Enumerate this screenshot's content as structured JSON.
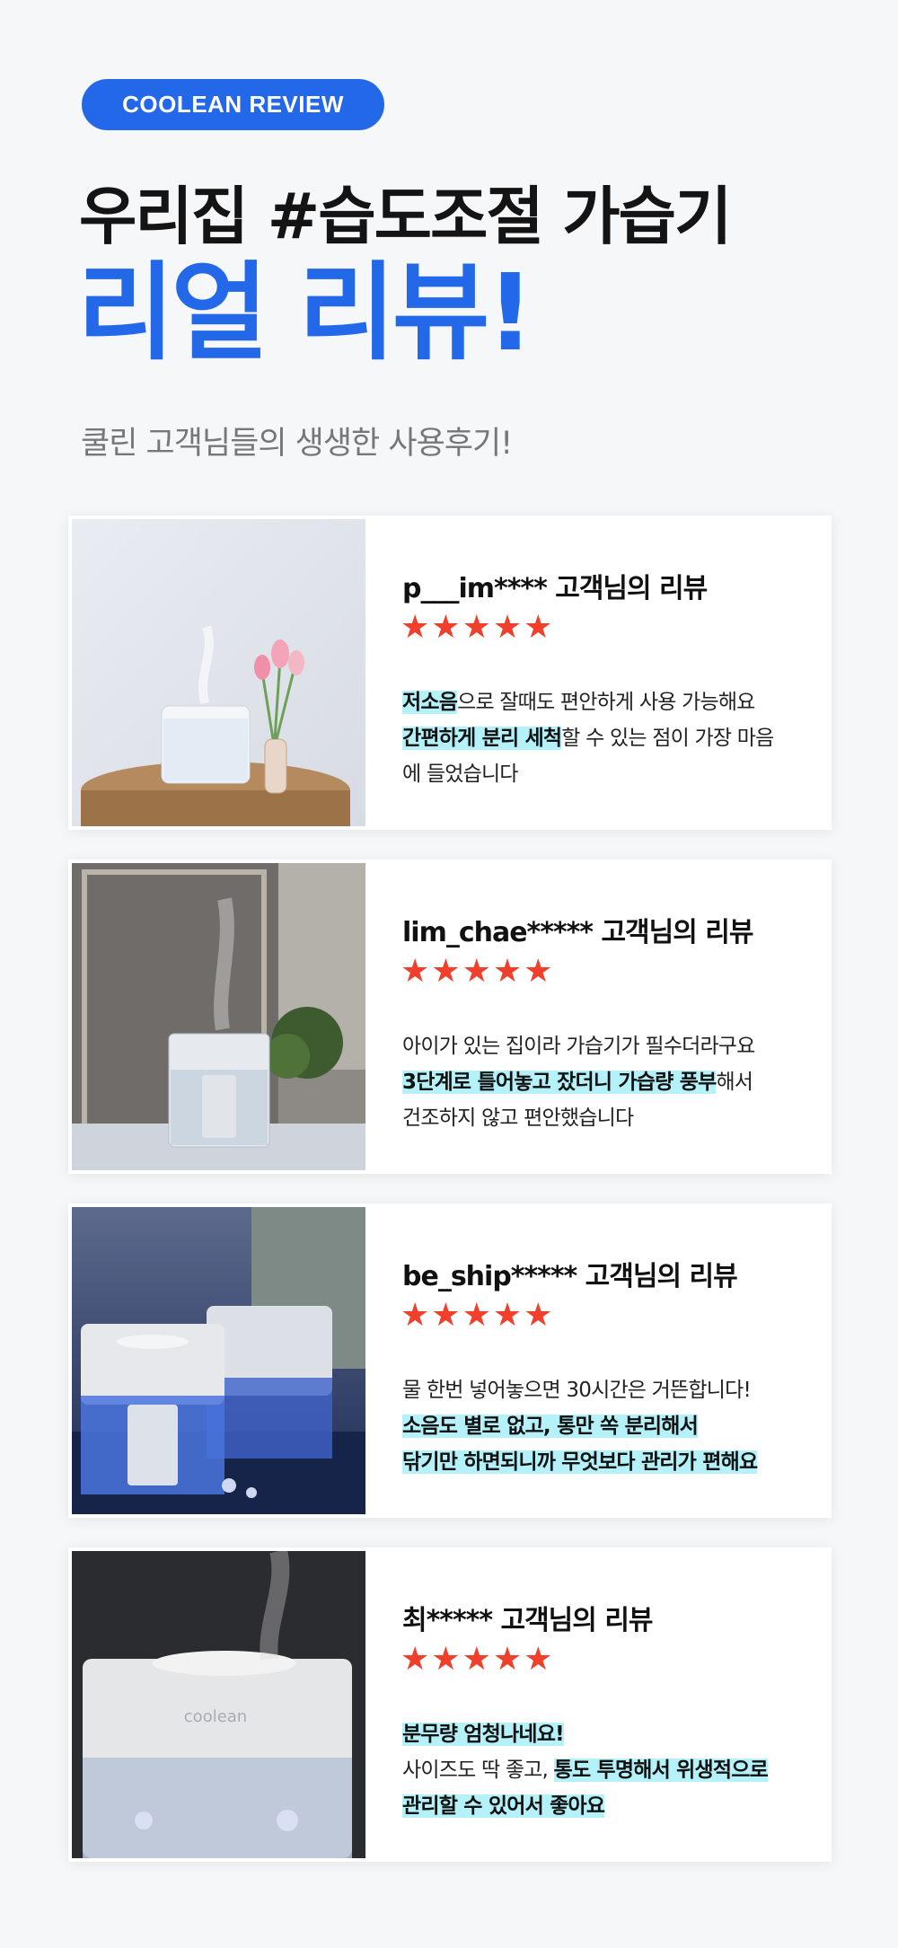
{
  "badge": "COOLEAN REVIEW",
  "title_line1": "우리집 #습도조절 가습기",
  "title_line2": "리얼 리뷰!",
  "subtitle": "쿨린 고객님들의 생생한 사용후기!",
  "colors": {
    "accent": "#2468ea",
    "star": "#f0402c",
    "highlight": "#b5f1f9"
  },
  "reviews": [
    {
      "reviewer": "p___im**** 고객님의 리뷰",
      "rating": 5,
      "photo": "humidifier-with-tulips",
      "lines": [
        [
          {
            "t": "저소음",
            "hl": true
          },
          {
            "t": "으로 잘때도 편안하게 사용 가능해요",
            "hl": false
          }
        ],
        [
          {
            "t": "간편하게 분리 세척",
            "hl": true
          },
          {
            "t": "할 수 있는 점이 가장 마음",
            "hl": false
          }
        ],
        [
          {
            "t": "에 들었습니다",
            "hl": false
          }
        ]
      ]
    },
    {
      "reviewer": "lim_chae***** 고객님의 리뷰",
      "rating": 5,
      "photo": "humidifier-with-plants",
      "lines": [
        [
          {
            "t": "아이가 있는 집이라 가습기가 필수더라구요",
            "hl": false
          }
        ],
        [
          {
            "t": "3단계로 틀어놓고 잤더니 가습량 풍부",
            "hl": true
          },
          {
            "t": "해서",
            "hl": false
          }
        ],
        [
          {
            "t": "건조하지 않고 편안했습니다",
            "hl": false
          }
        ]
      ]
    },
    {
      "reviewer": "be_ship***** 고객님의 리뷰",
      "rating": 5,
      "photo": "humidifiers-blue-light",
      "lines": [
        [
          {
            "t": "물 한번 넣어놓으면 30시간은 거뜬합니다!",
            "hl": false
          }
        ],
        [
          {
            "t": "소음도 별로 없고, 통만 쏙 분리해서",
            "hl": true
          }
        ],
        [
          {
            "t": "닦기만 하면되니까 무엇보다 관리가 편해요",
            "hl": true
          }
        ]
      ]
    },
    {
      "reviewer": "최***** 고객님의 리뷰",
      "rating": 5,
      "photo": "humidifier-closeup",
      "lines": [
        [
          {
            "t": "분무량 엄청나네요!",
            "hl": true
          }
        ],
        [
          {
            "t": "사이즈도 딱 좋고, ",
            "hl": false
          },
          {
            "t": "통도 투명해서 위생적으로",
            "hl": true
          }
        ],
        [
          {
            "t": "관리할 수 있어서 좋아요",
            "hl": true
          }
        ]
      ]
    }
  ]
}
